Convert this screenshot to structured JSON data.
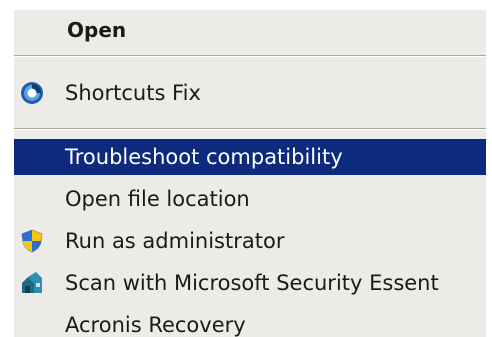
{
  "context_menu": {
    "items": [
      {
        "label": "Open",
        "icon": null
      },
      {
        "label": "Shortcuts Fix",
        "icon": "shortcuts-fix-icon"
      },
      {
        "label": "Troubleshoot compatibility",
        "icon": null,
        "selected": true
      },
      {
        "label": "Open file location",
        "icon": null
      },
      {
        "label": "Run as administrator",
        "icon": "uac-shield-icon"
      },
      {
        "label": "Scan with Microsoft Security Essent",
        "icon": "security-essentials-icon"
      },
      {
        "label": "Acronis Recovery",
        "icon": null
      }
    ]
  },
  "colors": {
    "menu_background": "#ecebe7",
    "selection_background": "#0d2a7d",
    "selection_text": "#ffffff"
  }
}
